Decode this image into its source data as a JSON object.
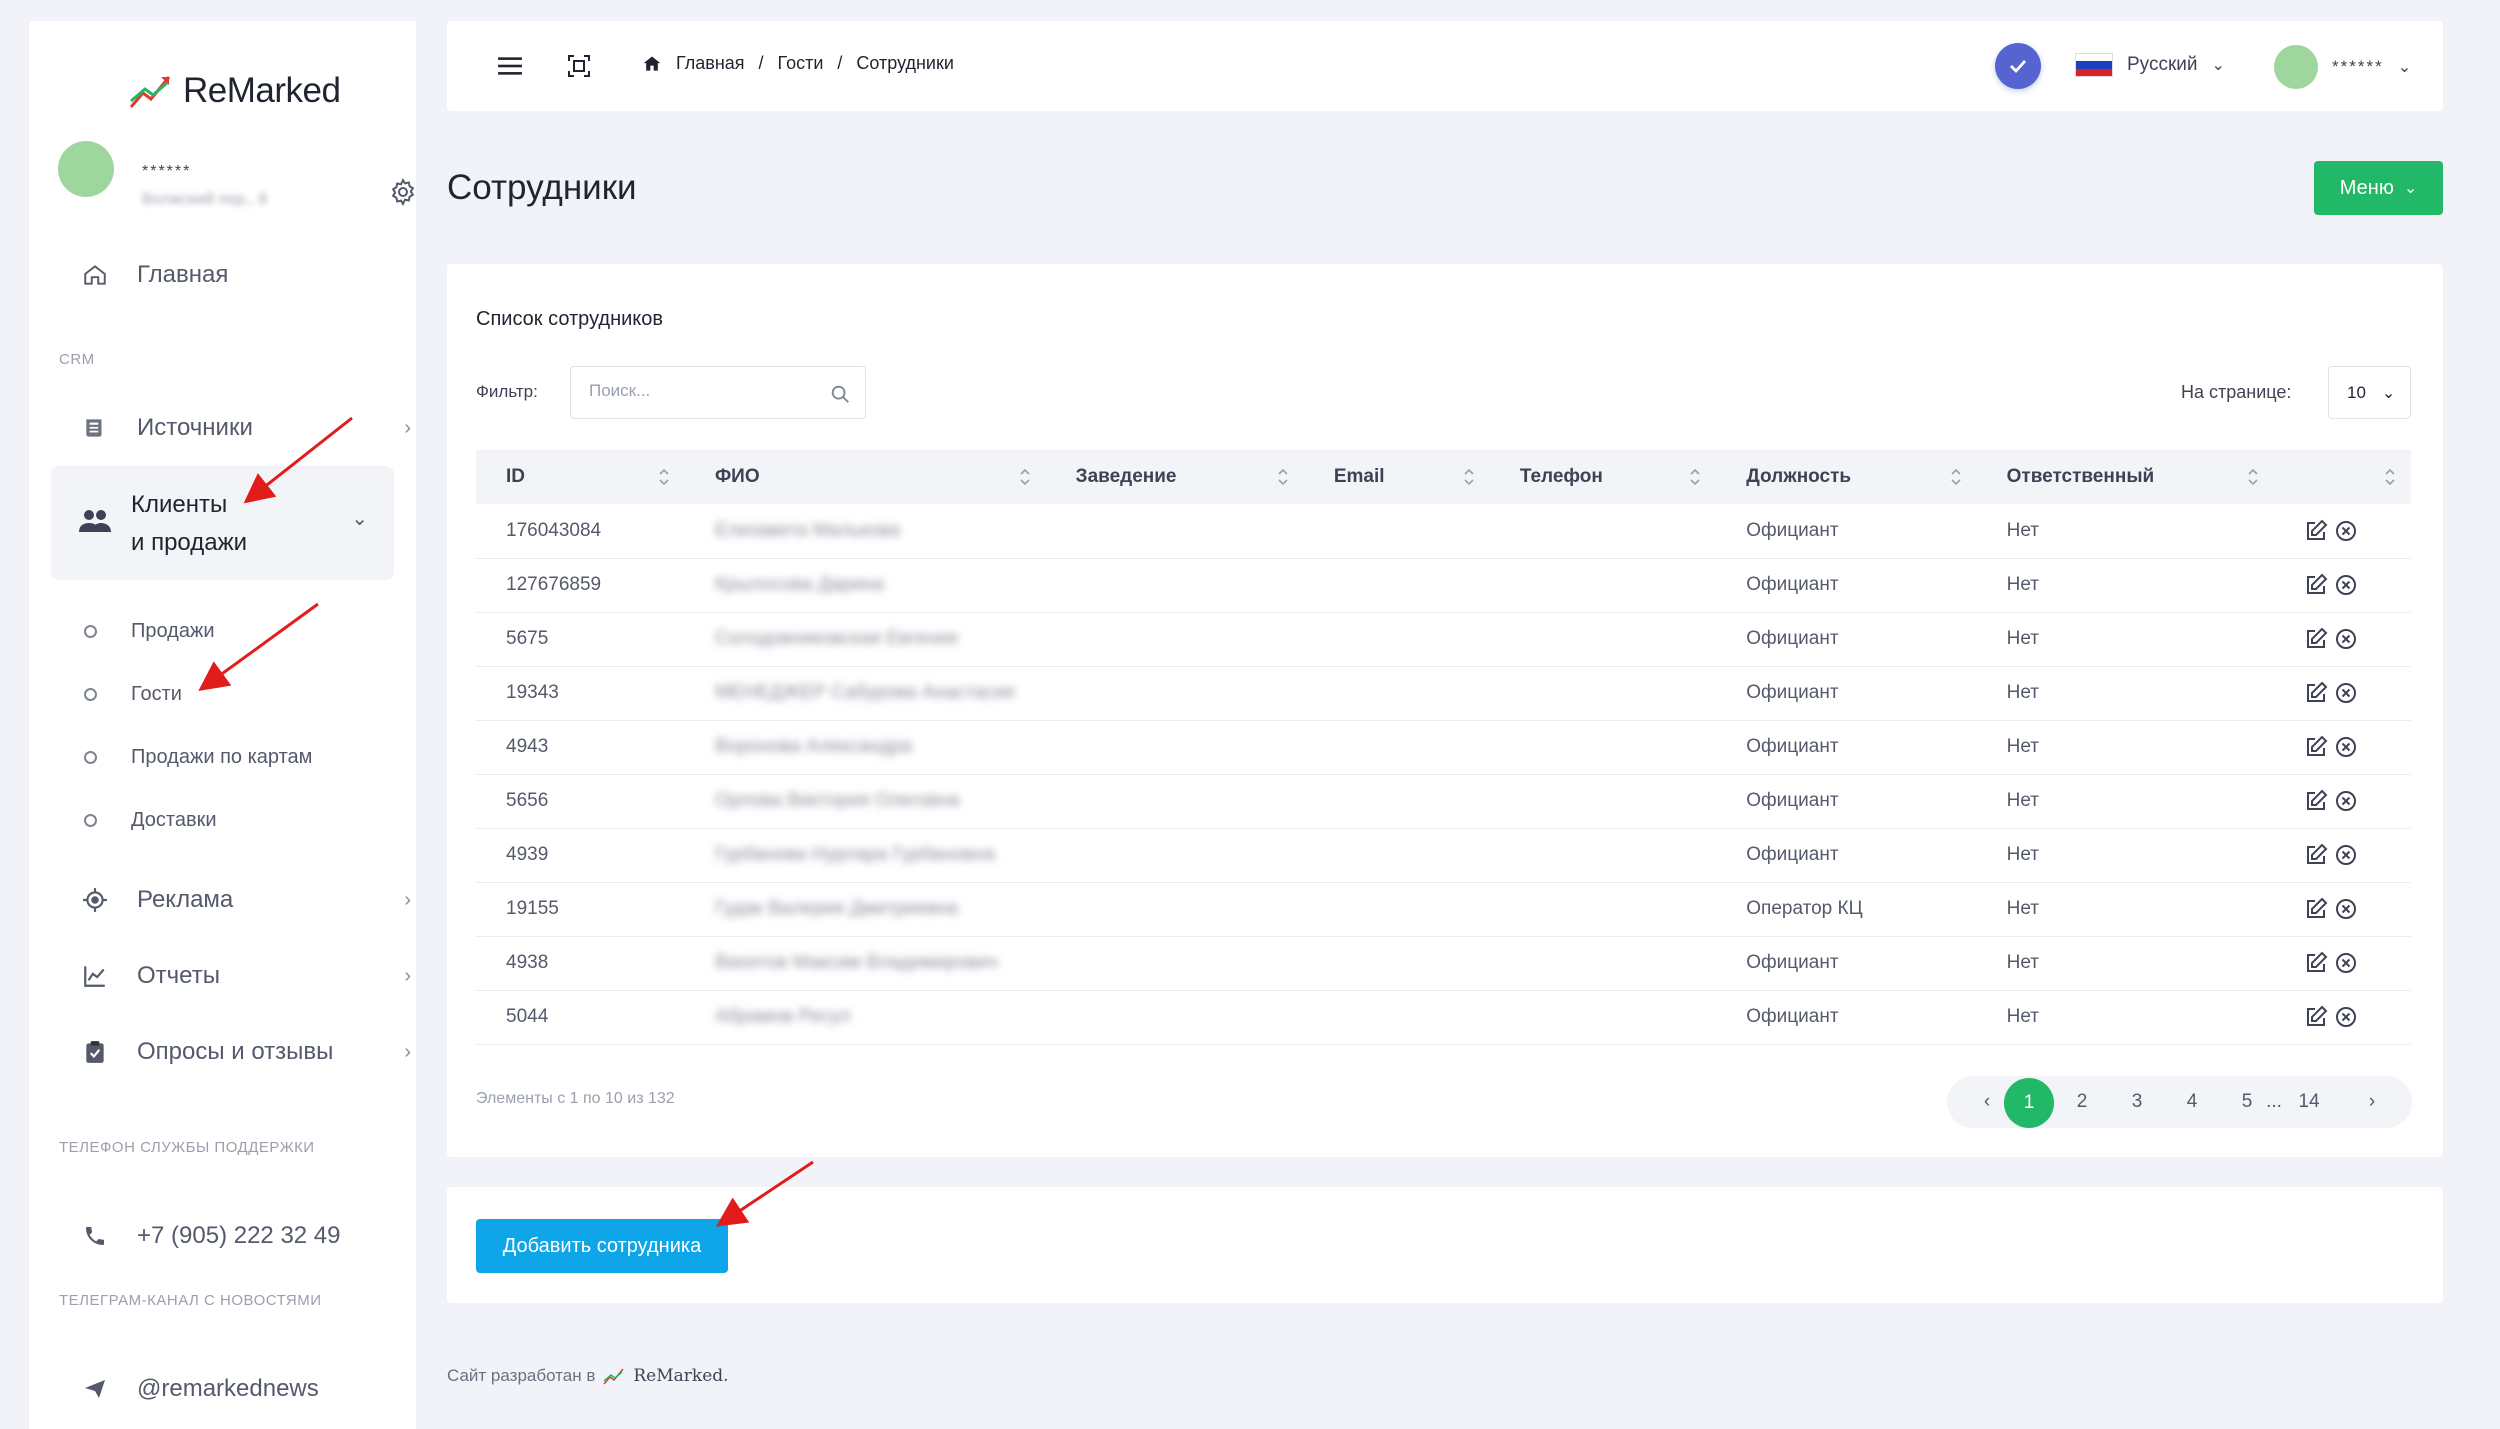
{
  "brand": {
    "name": "ReMarked"
  },
  "user": {
    "name": "******",
    "address": "Волжский пер., 8"
  },
  "sidebar": {
    "home": "Главная",
    "section_crm": "CRM",
    "sources": "Источники",
    "clients_line1": "Клиенты",
    "clients_line2": "и продажи",
    "sub": [
      "Продажи",
      "Гости",
      "Продажи по картам",
      "Доставки"
    ],
    "ads": "Реклама",
    "reports": "Отчеты",
    "surveys": "Опросы и отзывы",
    "support_label": "ТЕЛЕФОН СЛУЖБЫ ПОДДЕРЖКИ",
    "support_phone": "+7 (905) 222 32 49",
    "telegram_label": "ТЕЛЕГРАМ-КАНАЛ С НОВОСТЯМИ",
    "telegram_handle": "@remarkednews"
  },
  "header": {
    "breadcrumb": [
      "Главная",
      "Гости",
      "Сотрудники"
    ],
    "language": "Русский",
    "user_name": "******"
  },
  "page": {
    "title": "Сотрудники",
    "menu_button": "Меню"
  },
  "card": {
    "title": "Список сотрудников",
    "filter_label": "Фильтр:",
    "search_placeholder": "Поиск...",
    "per_page_label": "На странице:",
    "per_page_value": "10",
    "columns": [
      "ID",
      "ФИО",
      "Заведение",
      "Email",
      "Телефон",
      "Должность",
      "Ответственный"
    ],
    "rows": [
      {
        "id": "176043084",
        "name": "Елизавета Малькова",
        "position": "Официант",
        "responsible": "Нет"
      },
      {
        "id": "127676859",
        "name": "Крылосова Дарина",
        "position": "Официант",
        "responsible": "Нет"
      },
      {
        "id": "5675",
        "name": "Солодовниковская Евгения",
        "position": "Официант",
        "responsible": "Нет"
      },
      {
        "id": "19343",
        "name": "МЕНЕДЖЕР Сабурова Анастасия",
        "position": "Официант",
        "responsible": "Нет"
      },
      {
        "id": "4943",
        "name": "Воронова Александра",
        "position": "Официант",
        "responsible": "Нет"
      },
      {
        "id": "5656",
        "name": "Орлова Виктория Олеговна",
        "position": "Официант",
        "responsible": "Нет"
      },
      {
        "id": "4939",
        "name": "Гурбанова Нурлара Гурбановна",
        "position": "Официант",
        "responsible": "Нет"
      },
      {
        "id": "19155",
        "name": "Гудак Валерия Дмитриевна",
        "position": "Оператор КЦ",
        "responsible": "Нет"
      },
      {
        "id": "4938",
        "name": "Вахитов Максим Владимирович",
        "position": "Официант",
        "responsible": "Нет"
      },
      {
        "id": "5044",
        "name": "Абрамов Ресул",
        "position": "Официант",
        "responsible": "Нет"
      }
    ],
    "info": "Элементы с 1 по 10 из 132",
    "pages": [
      "1",
      "2",
      "3",
      "4",
      "5",
      "...",
      "14"
    ]
  },
  "add_button": "Добавить сотрудника",
  "footer": {
    "text": "Сайт разработан в",
    "brand": "ReMarked."
  },
  "colors": {
    "accent_green": "#21b867",
    "accent_blue": "#0ea5e9",
    "check_purple": "#5664d2",
    "annotation_red": "#e21b1b"
  }
}
